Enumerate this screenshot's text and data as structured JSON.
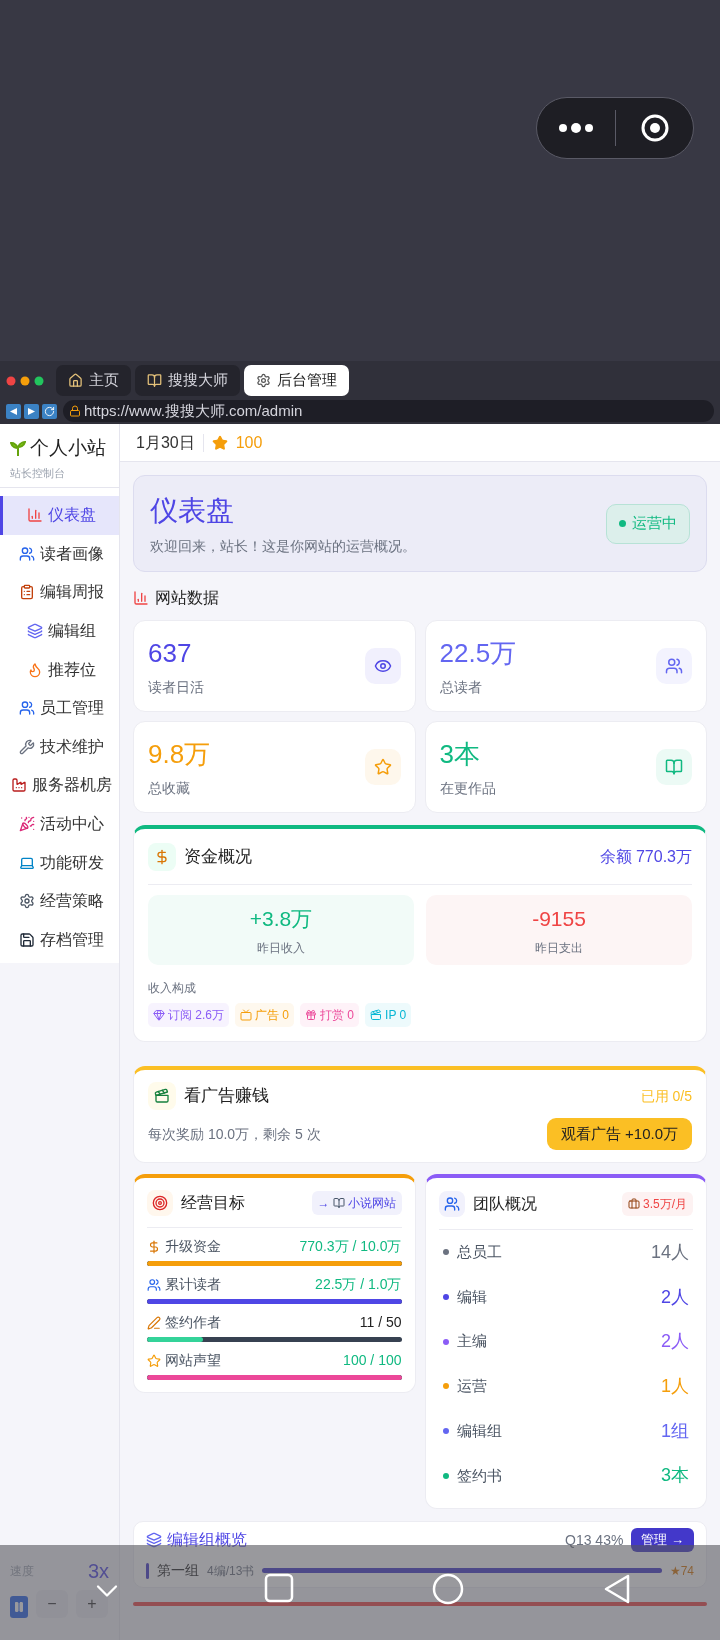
{
  "browser": {
    "tabs": [
      {
        "label": "主页",
        "selected": false
      },
      {
        "label": "搜搜大师",
        "selected": false
      },
      {
        "label": "后台管理",
        "selected": true
      }
    ],
    "url": "https://www.搜搜大师.com/admin"
  },
  "sidebar": {
    "title": "个人小站",
    "subtitle": "站长控制台",
    "items": [
      {
        "label": "仪表盘",
        "selected": true
      },
      {
        "label": "读者画像",
        "selected": false
      },
      {
        "label": "编辑周报",
        "selected": false
      },
      {
        "label": "编辑组",
        "selected": false
      },
      {
        "label": "推荐位",
        "selected": false
      },
      {
        "label": "员工管理",
        "selected": false
      },
      {
        "label": "技术维护",
        "selected": false
      },
      {
        "label": "服务器机房",
        "selected": false
      },
      {
        "label": "活动中心",
        "selected": false
      },
      {
        "label": "功能研发",
        "selected": false
      },
      {
        "label": "经营策略",
        "selected": false
      },
      {
        "label": "存档管理",
        "selected": false
      }
    ],
    "speed": {
      "label": "速度",
      "value": "3x",
      "minus": "−",
      "plus": "+"
    }
  },
  "header": {
    "date": "1月30日",
    "points": "100"
  },
  "hero": {
    "title": "仪表盘",
    "subtitle": "欢迎回来，站长！这是你网站的运营概况。",
    "status": "运营中"
  },
  "stats": {
    "title": "网站数据",
    "cards": [
      {
        "value": "637",
        "label": "读者日活",
        "color": "#4f46e5"
      },
      {
        "value": "22.5万",
        "label": "总读者",
        "color": "#6366f1"
      },
      {
        "value": "9.8万",
        "label": "总收藏",
        "color": "#f59e0b"
      },
      {
        "value": "3本",
        "label": "在更作品",
        "color": "#10b981"
      }
    ]
  },
  "finance": {
    "title": "资金概况",
    "balance": "余额 770.3万",
    "income": {
      "value": "+3.8万",
      "label": "昨日收入"
    },
    "expense": {
      "value": "-9155",
      "label": "昨日支出"
    },
    "breakdown_title": "收入构成",
    "tags": [
      {
        "label": "订阅 2.6万",
        "color": "#8b5cf6"
      },
      {
        "label": "广告 0",
        "color": "#f59e0b"
      },
      {
        "label": "打赏 0",
        "color": "#ec4899"
      },
      {
        "label": "IP 0",
        "color": "#06b6d4"
      }
    ]
  },
  "ads": {
    "title": "看广告赚钱",
    "used": "已用 0/5",
    "note": "每次奖励 10.0万，剩余 5 次",
    "button": "观看广告 +10.0万"
  },
  "goals": {
    "title": "经营目标",
    "link_arrow": "→",
    "link": "小说网站",
    "items": [
      {
        "label": "升级资金",
        "reading": "770.3万 / 10.0万",
        "level": 1,
        "color": "#f59e0b"
      },
      {
        "label": "累计读者",
        "reading": "22.5万 / 1.0万",
        "level": 1,
        "color": "#4f46e5"
      },
      {
        "label": "签约作者",
        "reading": "11 / 50",
        "level": 0.22,
        "color": "#34d399"
      },
      {
        "label": "网站声望",
        "reading": "100 / 100",
        "level": 1,
        "color": "#ec4899"
      }
    ]
  },
  "team": {
    "title": "团队概况",
    "cost": "3.5万/月",
    "rows": [
      {
        "label": "总员工",
        "value": "14人",
        "color": "#6b7280"
      },
      {
        "label": "编辑",
        "value": "2人",
        "color": "#4f46e5"
      },
      {
        "label": "主编",
        "value": "2人",
        "color": "#8b5cf6"
      },
      {
        "label": "运营",
        "value": "1人",
        "color": "#f59e0b"
      },
      {
        "label": "编辑组",
        "value": "1组",
        "color": "#6366f1"
      },
      {
        "label": "签约书",
        "value": "3本",
        "color": "#10b981"
      }
    ]
  },
  "groups": {
    "title": "编辑组概览",
    "stat": "Q13 43%",
    "button": "管理 →",
    "rows": [
      {
        "name": "第一组",
        "meta": "4编/13书",
        "level": 1,
        "score": "★74"
      }
    ]
  }
}
